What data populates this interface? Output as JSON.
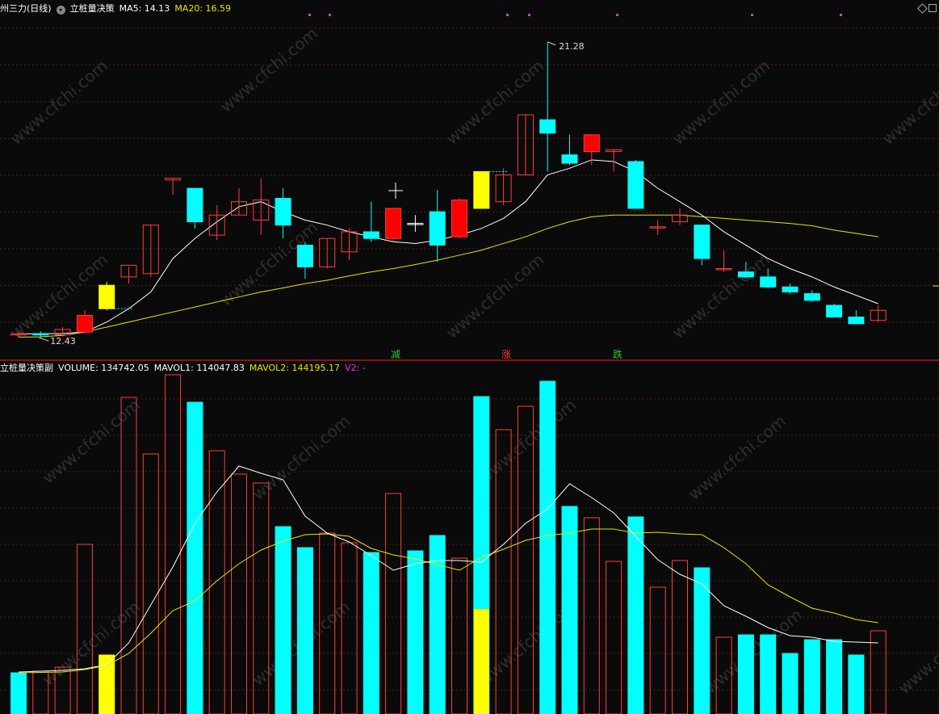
{
  "header": {
    "stock_name": "州三力(日线)",
    "indicator_name": "立桩量决策",
    "ma5_label": "MA5: 14.13",
    "ma20_label": "MA20: 16.59"
  },
  "sub_header": {
    "indicator_name": "立桩量决策副",
    "volume_label": "VOLUME: 134742.05",
    "mavol1_label": "MAVOL1: 114047.83",
    "mavol2_label": "MAVOL2: 144195.17",
    "v2_label": "V2: -"
  },
  "annotations": {
    "high_price": "21.28",
    "low_price": "12.43",
    "markers": [
      "减",
      "涨",
      "跌"
    ]
  },
  "watermark": "www.cfchi.com",
  "colors": {
    "up": "#ff3c3c",
    "down": "#00ffff",
    "signal": "#ffff00",
    "ma5": "#ffffff",
    "ma20": "#e6e600",
    "grid": "#5a1a1a",
    "divider": "#b01818",
    "magenta": "#d63cd6"
  },
  "chart_data": {
    "type": "candlestick",
    "price_ylim": [
      12.0,
      22.0
    ],
    "candles": [
      {
        "o": 12.55,
        "h": 12.62,
        "l": 12.45,
        "c": 12.55,
        "s": "up"
      },
      {
        "o": 12.55,
        "h": 12.62,
        "l": 12.43,
        "c": 12.55,
        "s": "down"
      },
      {
        "o": 12.52,
        "h": 12.75,
        "l": 12.48,
        "c": 12.68,
        "s": "up"
      },
      {
        "o": 12.6,
        "h": 13.25,
        "l": 12.55,
        "c": 13.1,
        "s": "upfill"
      },
      {
        "o": 14.0,
        "h": 14.1,
        "l": 13.25,
        "c": 13.3,
        "s": "signal"
      },
      {
        "o": 14.25,
        "h": 14.55,
        "l": 14.05,
        "c": 14.6,
        "s": "up"
      },
      {
        "o": 14.35,
        "h": 15.8,
        "l": 14.25,
        "c": 15.8,
        "s": "up"
      },
      {
        "o": 17.15,
        "h": 17.2,
        "l": 16.7,
        "c": 17.2,
        "s": "up"
      },
      {
        "o": 16.9,
        "h": 16.9,
        "l": 15.7,
        "c": 15.9,
        "s": "down"
      },
      {
        "o": 15.5,
        "h": 16.4,
        "l": 15.35,
        "c": 16.1,
        "s": "up"
      },
      {
        "o": 16.1,
        "h": 16.9,
        "l": 16.1,
        "c": 16.5,
        "s": "up"
      },
      {
        "o": 16.55,
        "h": 17.2,
        "l": 15.5,
        "c": 15.95,
        "s": "up"
      },
      {
        "o": 16.6,
        "h": 16.9,
        "l": 15.4,
        "c": 15.8,
        "s": "down"
      },
      {
        "o": 15.2,
        "h": 15.3,
        "l": 14.2,
        "c": 14.55,
        "s": "down"
      },
      {
        "o": 14.55,
        "h": 15.4,
        "l": 14.5,
        "c": 15.4,
        "s": "up"
      },
      {
        "o": 15.0,
        "h": 15.7,
        "l": 14.75,
        "c": 15.6,
        "s": "up"
      },
      {
        "o": 15.6,
        "h": 16.5,
        "l": 15.3,
        "c": 15.4,
        "s": "down"
      },
      {
        "o": 15.4,
        "h": 16.3,
        "l": 15.3,
        "c": 16.3,
        "s": "upfill"
      },
      {
        "o": 15.85,
        "h": 16.1,
        "l": 15.6,
        "c": 15.85,
        "s": "neutral"
      },
      {
        "o": 16.2,
        "h": 16.85,
        "l": 14.7,
        "c": 15.2,
        "s": "down"
      },
      {
        "o": 15.45,
        "h": 16.6,
        "l": 15.4,
        "c": 16.55,
        "s": "upfill"
      },
      {
        "o": 16.3,
        "h": 17.4,
        "l": 16.3,
        "c": 17.4,
        "s": "signal"
      },
      {
        "o": 16.5,
        "h": 17.5,
        "l": 16.4,
        "c": 17.3,
        "s": "up"
      },
      {
        "o": 17.3,
        "h": 19.1,
        "l": 17.3,
        "c": 19.1,
        "s": "up"
      },
      {
        "o": 18.95,
        "h": 21.28,
        "l": 17.4,
        "c": 18.55,
        "s": "down"
      },
      {
        "o": 17.9,
        "h": 18.5,
        "l": 17.6,
        "c": 17.65,
        "s": "down"
      },
      {
        "o": 18.0,
        "h": 18.3,
        "l": 17.6,
        "c": 18.5,
        "s": "upfill"
      },
      {
        "o": 18.0,
        "h": 18.05,
        "l": 17.4,
        "c": 18.05,
        "s": "up"
      },
      {
        "o": 17.7,
        "h": 17.75,
        "l": 16.3,
        "c": 16.3,
        "s": "down"
      },
      {
        "o": 15.75,
        "h": 15.95,
        "l": 15.5,
        "c": 15.75,
        "s": "up"
      },
      {
        "o": 15.9,
        "h": 16.3,
        "l": 15.8,
        "c": 16.1,
        "s": "up"
      },
      {
        "o": 15.8,
        "h": 15.8,
        "l": 14.6,
        "c": 14.8,
        "s": "down"
      },
      {
        "o": 14.5,
        "h": 15.05,
        "l": 14.4,
        "c": 14.5,
        "s": "up"
      },
      {
        "o": 14.4,
        "h": 14.7,
        "l": 14.2,
        "c": 14.25,
        "s": "down"
      },
      {
        "o": 14.25,
        "h": 14.5,
        "l": 13.9,
        "c": 13.95,
        "s": "down"
      },
      {
        "o": 13.95,
        "h": 14.05,
        "l": 13.75,
        "c": 13.8,
        "s": "down"
      },
      {
        "o": 13.75,
        "h": 13.85,
        "l": 13.5,
        "c": 13.55,
        "s": "down"
      },
      {
        "o": 13.4,
        "h": 13.45,
        "l": 13.05,
        "c": 13.05,
        "s": "down"
      },
      {
        "o": 13.05,
        "h": 13.25,
        "l": 12.95,
        "c": 12.85,
        "s": "down"
      },
      {
        "o": 12.95,
        "h": 13.4,
        "l": 12.9,
        "c": 13.25,
        "s": "up"
      }
    ],
    "ma5": [
      12.55,
      12.55,
      12.56,
      12.6,
      12.9,
      13.3,
      13.8,
      14.8,
      15.4,
      15.9,
      16.35,
      16.5,
      16.2,
      15.95,
      15.8,
      15.6,
      15.45,
      15.3,
      15.25,
      15.35,
      15.5,
      15.7,
      16.0,
      16.5,
      17.3,
      17.5,
      17.75,
      17.7,
      17.4,
      16.9,
      16.5,
      16.1,
      15.6,
      15.2,
      14.8,
      14.5,
      14.25,
      13.95,
      13.7,
      13.45
    ],
    "ma20": [
      12.45,
      12.46,
      12.5,
      12.6,
      12.75,
      12.9,
      13.05,
      13.2,
      13.35,
      13.5,
      13.65,
      13.8,
      13.92,
      14.05,
      14.15,
      14.28,
      14.4,
      14.5,
      14.62,
      14.75,
      14.9,
      15.05,
      15.25,
      15.45,
      15.7,
      15.9,
      16.05,
      16.1,
      16.1,
      16.1,
      16.1,
      16.05,
      16.0,
      15.95,
      15.9,
      15.85,
      15.78,
      15.65,
      15.55,
      15.45
    ],
    "volume_ylim": [
      0,
      420000
    ],
    "volumes": [
      {
        "v": 51000,
        "s": "down"
      },
      {
        "v": 53000,
        "s": "up"
      },
      {
        "v": 58000,
        "s": "up"
      },
      {
        "v": 210000,
        "s": "up"
      },
      {
        "v": 73000,
        "s": "signal"
      },
      {
        "v": 392000,
        "s": "up"
      },
      {
        "v": 322000,
        "s": "up"
      },
      {
        "v": 420000,
        "s": "up"
      },
      {
        "v": 386000,
        "s": "down"
      },
      {
        "v": 326000,
        "s": "up"
      },
      {
        "v": 297000,
        "s": "up"
      },
      {
        "v": 286000,
        "s": "up"
      },
      {
        "v": 232000,
        "s": "down"
      },
      {
        "v": 206000,
        "s": "down"
      },
      {
        "v": 224000,
        "s": "up"
      },
      {
        "v": 212000,
        "s": "up"
      },
      {
        "v": 200000,
        "s": "down"
      },
      {
        "v": 273000,
        "s": "up"
      },
      {
        "v": 202000,
        "s": "down"
      },
      {
        "v": 221000,
        "s": "down"
      },
      {
        "v": 193000,
        "s": "up"
      },
      {
        "v": 393000,
        "s": "down"
      },
      {
        "v": 352000,
        "s": "up"
      },
      {
        "v": 381000,
        "s": "up"
      },
      {
        "v": 412000,
        "s": "down"
      },
      {
        "v": 257000,
        "s": "down"
      },
      {
        "v": 243000,
        "s": "up"
      },
      {
        "v": 189000,
        "s": "up"
      },
      {
        "v": 244000,
        "s": "down"
      },
      {
        "v": 157000,
        "s": "up"
      },
      {
        "v": 190000,
        "s": "up"
      },
      {
        "v": 181000,
        "s": "down"
      },
      {
        "v": 95000,
        "s": "up"
      },
      {
        "v": 98000,
        "s": "down"
      },
      {
        "v": 98000,
        "s": "down"
      },
      {
        "v": 75000,
        "s": "down"
      },
      {
        "v": 92000,
        "s": "down"
      },
      {
        "v": 92000,
        "s": "down"
      },
      {
        "v": 73000,
        "s": "down"
      },
      {
        "v": 103000,
        "s": "up"
      }
    ],
    "volume_signal": [
      {
        "index": 4,
        "v": 73000
      },
      {
        "index": 21,
        "v": 130000
      }
    ],
    "mavol1": [
      52000,
      53000,
      54000,
      56000,
      61000,
      88000,
      135000,
      182000,
      236000,
      275000,
      307000,
      298000,
      290000,
      245000,
      224000,
      213000,
      196000,
      178000,
      186000,
      190000,
      190000,
      188000,
      210000,
      236000,
      254000,
      285000,
      268000,
      249000,
      220000,
      191000,
      173000,
      161000,
      134000,
      121000,
      107000,
      97000,
      95000,
      90000,
      89000,
      88000
    ],
    "mavol2": [
      51000,
      51500,
      52000,
      55000,
      60000,
      75000,
      100000,
      128000,
      140000,
      165000,
      186000,
      203000,
      214000,
      222000,
      223000,
      220000,
      205000,
      197000,
      192000,
      185000,
      178000,
      194000,
      204000,
      215000,
      221000,
      224000,
      229000,
      229000,
      224000,
      225000,
      223000,
      222000,
      206000,
      186000,
      160000,
      145000,
      131000,
      125000,
      117000,
      113000
    ]
  }
}
